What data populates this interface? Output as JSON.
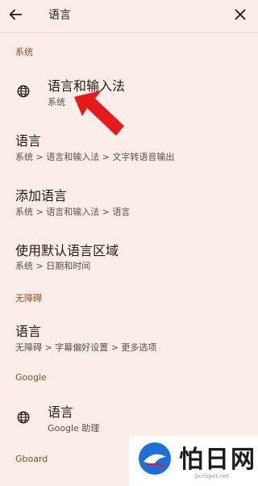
{
  "topbar": {
    "title": "语言"
  },
  "sections": {
    "system": "系统",
    "accessibility": "无障碍",
    "google": "Google",
    "gboard": "Gboard"
  },
  "items": {
    "language_input": {
      "title": "语言和输入法",
      "subtitle": "系统"
    },
    "language_tts": {
      "title": "语言",
      "subtitle": "系统 > 语言和输入法 > 文字转语音输出"
    },
    "add_language": {
      "title": "添加语言",
      "subtitle": "系统 > 语言和输入法 > 语言"
    },
    "default_region": {
      "title": "使用默认语言区域",
      "subtitle": "系统 > 日期和时间"
    },
    "a11y_language": {
      "title": "语言",
      "subtitle": "无障碍 > 字幕偏好设置 > 更多选项"
    },
    "google_language": {
      "title": "语言",
      "subtitle": "Google 助理"
    }
  },
  "watermark": {
    "text": "怕日网",
    "url": "pcrispet.net"
  },
  "colors": {
    "background": "#fbeee8",
    "section_header": "#8e4f1f",
    "arrow": "#e31b1b"
  },
  "icons": [
    "back-arrow-icon",
    "close-icon",
    "globe-icon",
    "red-arrow-annotation"
  ]
}
